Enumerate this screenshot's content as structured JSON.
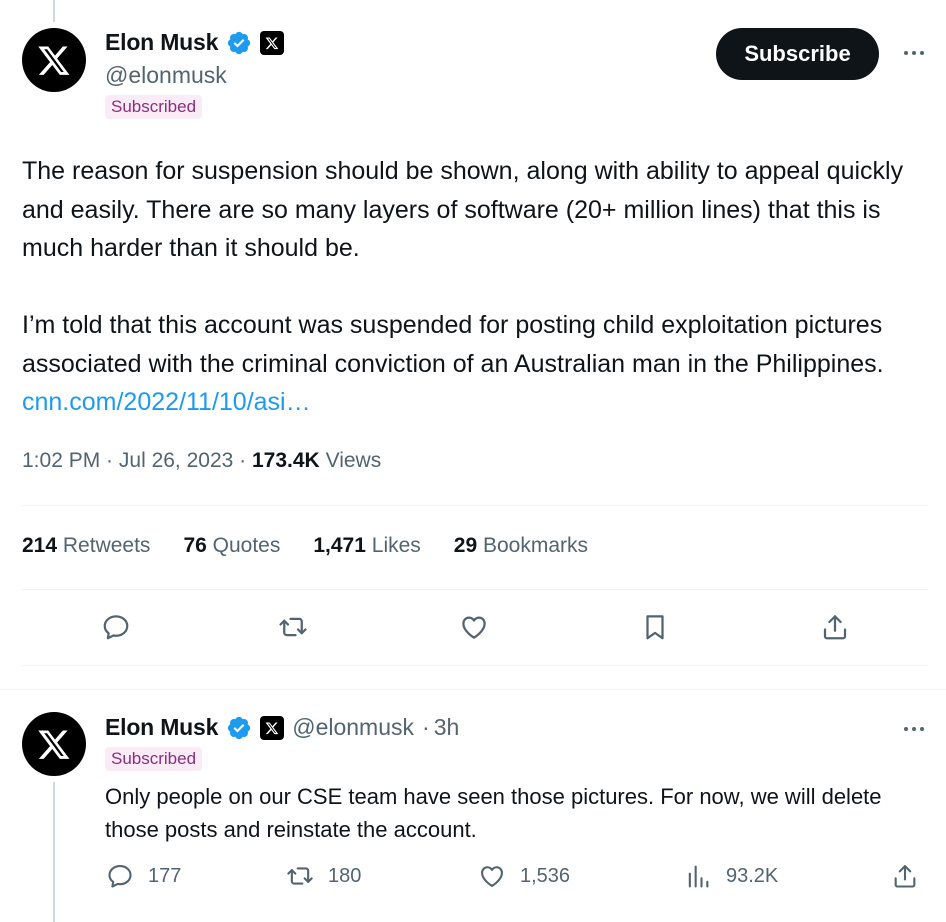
{
  "main_tweet": {
    "author": {
      "display_name": "Elon Musk",
      "handle": "@elonmusk",
      "subscribed_badge": "Subscribed"
    },
    "subscribe_label": "Subscribe",
    "paragraphs": [
      "The reason for suspension should be shown, along with ability to appeal quickly and easily. There are so many layers of software (20+ million lines) that this is much harder than it should be.",
      "I’m told that this account was suspended for posting child exploitation pictures associated with the criminal conviction of an Australian man in the Philippines."
    ],
    "link_text": "cnn.com/2022/11/10/asi…",
    "time": "1:02 PM",
    "date": "Jul 26, 2023",
    "views_count": "173.4K",
    "views_label": "Views",
    "stats": {
      "retweets": {
        "count": "214",
        "label": "Retweets"
      },
      "quotes": {
        "count": "76",
        "label": "Quotes"
      },
      "likes": {
        "count": "1,471",
        "label": "Likes"
      },
      "bookmarks": {
        "count": "29",
        "label": "Bookmarks"
      }
    }
  },
  "reply_tweet": {
    "author": {
      "display_name": "Elon Musk",
      "handle": "@elonmusk",
      "time_ago": "3h",
      "subscribed_badge": "Subscribed"
    },
    "text": "Only people on our CSE team have seen those pictures. For now, we will delete those posts and reinstate the account.",
    "counts": {
      "replies": "177",
      "retweets": "180",
      "likes": "1,536",
      "views": "93.2K"
    }
  },
  "colors": {
    "text": "#0f1419",
    "secondary": "#536471",
    "link": "#1d9bf0",
    "verified": "#1d9bf0",
    "subscribed_bg": "#faecf6",
    "subscribed_text": "#8c2e7e",
    "divider": "#eff3f4"
  },
  "icons": [
    "x-logo-icon",
    "verified-badge-icon",
    "x-affiliate-icon",
    "more-icon",
    "reply-icon",
    "retweet-icon",
    "like-icon",
    "bookmark-icon",
    "share-icon",
    "views-icon"
  ]
}
